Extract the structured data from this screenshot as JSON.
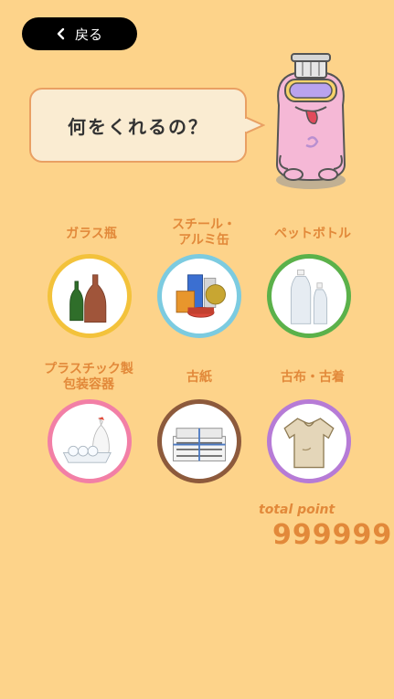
{
  "header": {
    "back_label": "戻る"
  },
  "bubble": {
    "text": "何をくれるの？"
  },
  "categories": [
    {
      "label": "ガラス瓶",
      "icon": "glass-bottles-icon"
    },
    {
      "label": "スチール・\nアルミ缶",
      "icon": "cans-icon"
    },
    {
      "label": "ペットボトル",
      "icon": "pet-bottles-icon"
    },
    {
      "label": "プラスチック製\n包装容器",
      "icon": "plastic-packaging-icon"
    },
    {
      "label": "古紙",
      "icon": "newspaper-icon"
    },
    {
      "label": "古布・古着",
      "icon": "old-clothes-icon"
    }
  ],
  "points": {
    "label": "total point",
    "value": "999999"
  },
  "colors": {
    "background": "#fdd38a",
    "accent": "#e2893a",
    "back_button": "#000000"
  }
}
